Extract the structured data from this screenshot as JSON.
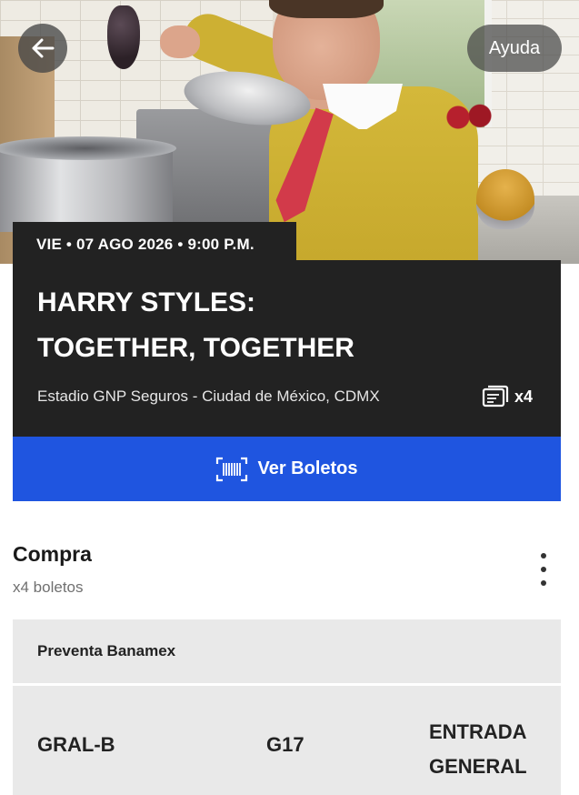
{
  "header": {
    "back_icon": "arrow-left-icon",
    "help_label": "Ayuda"
  },
  "event": {
    "date_line": "VIE • 07 AGO 2026 • 9:00 P.M.",
    "title_line1": "HARRY STYLES:",
    "title_line2": "TOGETHER, TOGETHER",
    "venue": "Estadio GNP Seguros - Ciudad de México, CDMX",
    "ticket_count": "x4",
    "ticket_icon": "tickets-icon"
  },
  "actions": {
    "view_tickets_label": "Ver Boletos",
    "view_tickets_icon": "barcode-icon"
  },
  "purchase": {
    "title": "Compra",
    "subtitle": "x4 boletos",
    "menu_icon": "more-vertical-icon",
    "presale_label": "Preventa Banamex",
    "ticket": {
      "section": "GRAL-B",
      "row": "G17",
      "type_line1": "ENTRADA",
      "type_line2": "GENERAL"
    }
  },
  "colors": {
    "card_bg": "#222222",
    "accent_blue": "#1f55e0",
    "panel_gray": "#e9e9e9"
  }
}
